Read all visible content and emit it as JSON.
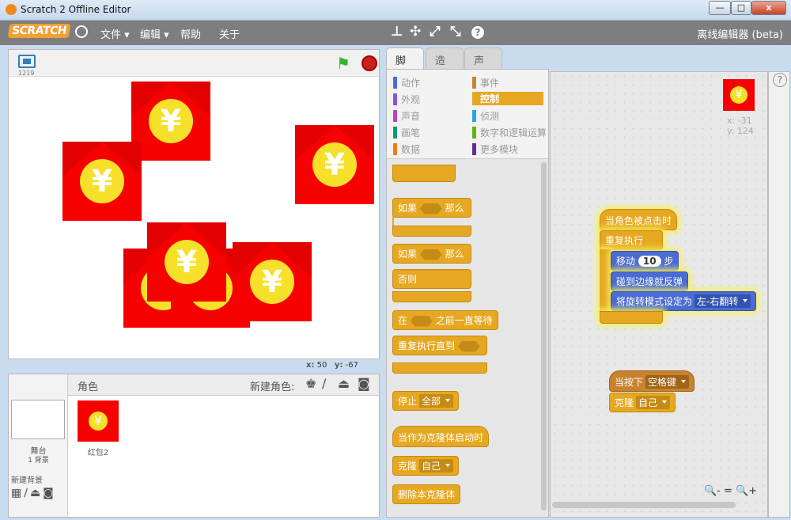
{
  "window": {
    "title": "Scratch 2 Offline Editor",
    "min": "—",
    "max": "□",
    "close": "x"
  },
  "menu": {
    "logo": "SCRATCH",
    "file": "文件 ▾",
    "edit": "编辑 ▾",
    "help": "帮助",
    "about": "关于",
    "edition": "离线编辑器 (beta)"
  },
  "stage": {
    "version": "1219",
    "mouse_x_label": "x:",
    "mouse_x": "50",
    "mouse_y_label": "y:",
    "mouse_y": "-67",
    "coin_glyph": "¥"
  },
  "sprites": {
    "header": "角色",
    "new_sprite": "新建角色:",
    "stage_label": "舞台",
    "stage_backdrops": "1 背景",
    "new_backdrop": "新建背景",
    "sprite_name": "红包2"
  },
  "tabs": [
    "脚本",
    "造型",
    "声音"
  ],
  "categories": {
    "left": [
      {
        "label": "动作",
        "color": "#4a6cd4"
      },
      {
        "label": "外观",
        "color": "#8a55d7"
      },
      {
        "label": "声音",
        "color": "#bb42c3"
      },
      {
        "label": "画笔",
        "color": "#0e9a6c"
      },
      {
        "label": "数据",
        "color": "#ee7d16"
      }
    ],
    "right": [
      {
        "label": "事件",
        "color": "#c88330"
      },
      {
        "label": "控制",
        "color": "#e6a822"
      },
      {
        "label": "侦测",
        "color": "#2ca5e2"
      },
      {
        "label": "数字和逻辑运算",
        "color": "#5cb712"
      },
      {
        "label": "更多模块",
        "color": "#632d99"
      }
    ]
  },
  "palette": {
    "if": "如果",
    "then": "那么",
    "else": "否则",
    "wait_until_pre": "在",
    "wait_until_post": "之前一直等待",
    "repeat_until": "重复执行直到",
    "stop": "停止",
    "stop_opt": "全部",
    "clone_start": "当作为克隆体启动时",
    "clone": "克隆",
    "clone_opt": "自己",
    "delete_clone": "删除本克隆体"
  },
  "script": {
    "sprite_x": "x: -31",
    "sprite_y": "y: 124",
    "hat_click": "当角色被点击时",
    "forever": "重复执行",
    "move_pre": "移动",
    "move_num": "10",
    "move_post": "步",
    "bounce": "碰到边缘就反弹",
    "rotation": "将旋转模式设定为",
    "rotation_opt": "左-右翻转",
    "key_hat": "当按下",
    "key_opt": "空格键",
    "clone": "克隆",
    "clone_opt": "自己"
  },
  "zoom": {
    "out": "🔍-",
    "reset": "=",
    "in": "🔍+"
  },
  "help": "?"
}
